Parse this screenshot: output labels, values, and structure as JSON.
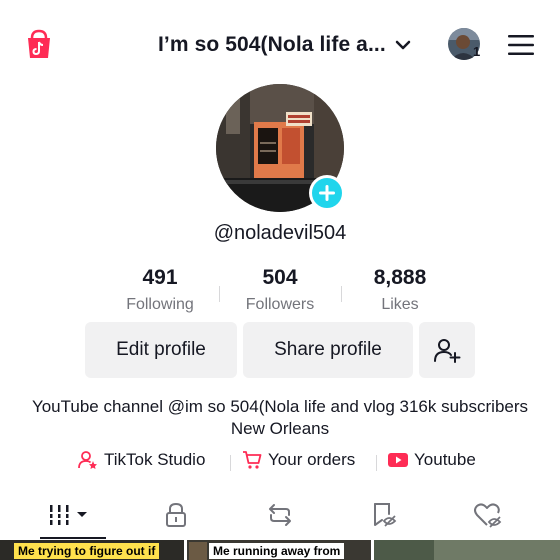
{
  "header": {
    "title": "I’m so 504(Nola life a...",
    "notification_count": "1",
    "icons": [
      "tiktok-shop-icon",
      "chevron-down-icon",
      "account-avatar",
      "hamburger-menu-icon"
    ]
  },
  "profile": {
    "username": "@noladevil504",
    "stats": [
      {
        "value": "491",
        "label": "Following"
      },
      {
        "value": "504",
        "label": "Followers"
      },
      {
        "value": "8,888",
        "label": "Likes"
      }
    ]
  },
  "actions": {
    "edit_profile": "Edit profile",
    "share_profile": "Share profile"
  },
  "bio": "YouTube channel @im so 504(Nola life and vlog 316k subscribers New Orleans",
  "links": [
    {
      "label": "TikTok Studio",
      "icon": "tiktok-studio-icon"
    },
    {
      "label": "Your orders",
      "icon": "shopping-cart-icon"
    },
    {
      "label": "Youtube",
      "icon": "youtube-icon"
    }
  ],
  "tabs": [
    "videos-grid-icon",
    "lock-icon",
    "repost-icon",
    "saved-icon",
    "liked-icon"
  ],
  "thumbnails": [
    {
      "caption": "Me trying to figure out if"
    },
    {
      "caption": "Me running away from"
    },
    {
      "caption": ""
    }
  ],
  "colors": {
    "accent_plus": "#20d5ec",
    "shop_red": "#fe2c55",
    "youtube_red": "#fe2c55",
    "text": "#161823",
    "muted": "#73747b",
    "button_bg": "#f1f1f2"
  }
}
